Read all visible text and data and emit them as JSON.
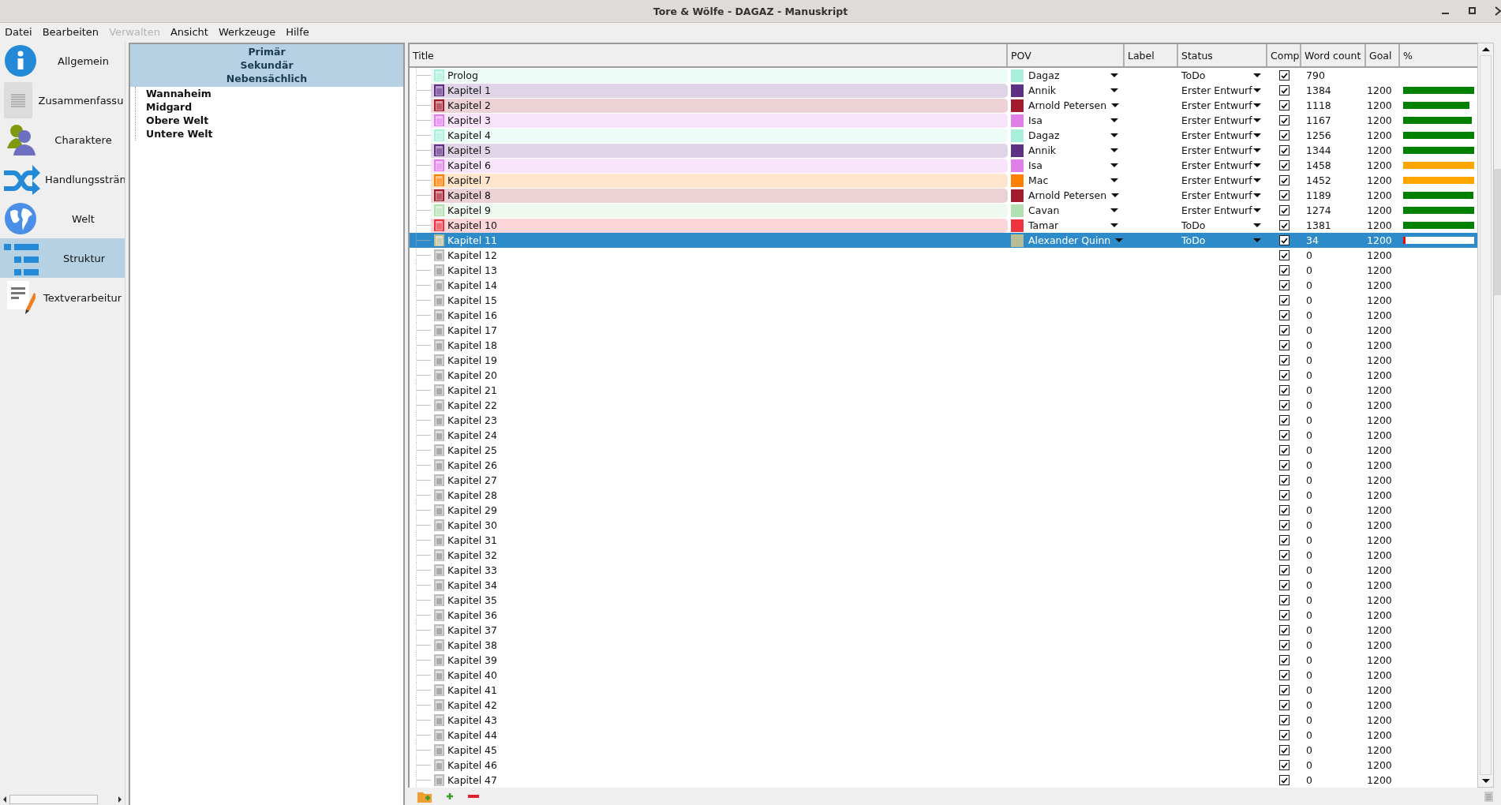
{
  "window": {
    "title": "Tore & Wölfe - DAGAZ - Manuskript"
  },
  "menu": [
    {
      "label": "Datei",
      "disabled": false
    },
    {
      "label": "Bearbeiten",
      "disabled": false
    },
    {
      "label": "Verwalten",
      "disabled": true
    },
    {
      "label": "Ansicht",
      "disabled": false
    },
    {
      "label": "Werkzeuge",
      "disabled": false
    },
    {
      "label": "Hilfe",
      "disabled": false
    }
  ],
  "sidebar": {
    "items": [
      {
        "label": "Allgemein",
        "kind": "info",
        "selected": false
      },
      {
        "label": "Zusammenfassu",
        "kind": "summary",
        "selected": false
      },
      {
        "label": "Charaktere",
        "kind": "characters",
        "selected": false
      },
      {
        "label": "Handlungssträn",
        "kind": "plots",
        "selected": false
      },
      {
        "label": "Welt",
        "kind": "world",
        "selected": false
      },
      {
        "label": "Struktur",
        "kind": "outline",
        "selected": true
      },
      {
        "label": "Textverarbeitur",
        "kind": "editor",
        "selected": false
      }
    ]
  },
  "world_panel": {
    "headers": [
      "Primär",
      "Sekundär",
      "Nebensächlich"
    ],
    "items": [
      "Wannaheim",
      "Midgard",
      "Obere Welt",
      "Untere Welt"
    ]
  },
  "table": {
    "columns": [
      "Title",
      "POV",
      "Label",
      "Status",
      "Comp",
      "Word count",
      "Goal",
      "%"
    ],
    "rows": [
      {
        "title": "Prolog",
        "pov": {
          "name": "Dagaz",
          "color": "#a8f0dc"
        },
        "status": "ToDo",
        "checked": true,
        "word_count": "790",
        "selected": false
      },
      {
        "title": "Kapitel 1",
        "pov": {
          "name": "Annik",
          "color": "#5f2f85"
        },
        "status": "Erster Entwurf",
        "checked": true,
        "word_count": "1384",
        "goal": "1200",
        "progress": {
          "level": 1,
          "color": "#008000"
        },
        "selected": false
      },
      {
        "title": "Kapitel 2",
        "pov": {
          "name": "Arnold Petersen",
          "color": "#a21c2e"
        },
        "status": "Erster Entwurf",
        "checked": true,
        "word_count": "1118",
        "goal": "1200",
        "progress": {
          "level": 0.93,
          "color": "#008000"
        },
        "selected": false
      },
      {
        "title": "Kapitel 3",
        "pov": {
          "name": "Isa",
          "color": "#e07fea"
        },
        "status": "Erster Entwurf",
        "checked": true,
        "word_count": "1167",
        "goal": "1200",
        "progress": {
          "level": 0.97,
          "color": "#008000"
        },
        "selected": false
      },
      {
        "title": "Kapitel 4",
        "pov": {
          "name": "Dagaz",
          "color": "#a8f0dc"
        },
        "status": "Erster Entwurf",
        "checked": true,
        "word_count": "1256",
        "goal": "1200",
        "progress": {
          "level": 1,
          "color": "#008000"
        },
        "selected": false
      },
      {
        "title": "Kapitel 5",
        "pov": {
          "name": "Annik",
          "color": "#5f2f85"
        },
        "status": "Erster Entwurf",
        "checked": true,
        "word_count": "1344",
        "goal": "1200",
        "progress": {
          "level": 1,
          "color": "#008000"
        },
        "selected": false
      },
      {
        "title": "Kapitel 6",
        "pov": {
          "name": "Isa",
          "color": "#e07fea"
        },
        "status": "Erster Entwurf",
        "checked": true,
        "word_count": "1458",
        "goal": "1200",
        "progress": {
          "level": 1,
          "color": "#ffa500"
        },
        "selected": false
      },
      {
        "title": "Kapitel 7",
        "pov": {
          "name": "Mac",
          "color": "#ff7f00"
        },
        "status": "Erster Entwurf",
        "checked": true,
        "word_count": "1452",
        "goal": "1200",
        "progress": {
          "level": 1,
          "color": "#ffa500"
        },
        "selected": false
      },
      {
        "title": "Kapitel 8",
        "pov": {
          "name": "Arnold Petersen",
          "color": "#a21c2e"
        },
        "status": "Erster Entwurf",
        "checked": true,
        "word_count": "1189",
        "goal": "1200",
        "progress": {
          "level": 0.99,
          "color": "#008000"
        },
        "selected": false
      },
      {
        "title": "Kapitel 9",
        "pov": {
          "name": "Cavan",
          "color": "#b3e0b3"
        },
        "status": "Erster Entwurf",
        "checked": true,
        "word_count": "1274",
        "goal": "1200",
        "progress": {
          "level": 1,
          "color": "#008000"
        },
        "selected": false
      },
      {
        "title": "Kapitel 10",
        "pov": {
          "name": "Tamar",
          "color": "#ee3340"
        },
        "status": "ToDo",
        "checked": true,
        "word_count": "1381",
        "goal": "1200",
        "progress": {
          "level": 1,
          "color": "#008000"
        },
        "selected": false
      },
      {
        "title": "Kapitel 11",
        "pov": {
          "name": "Alexander Quinn",
          "color": "#b9bd95"
        },
        "status": "ToDo",
        "checked": true,
        "word_count": "34",
        "goal": "1200",
        "progress": {
          "level": 0.03,
          "color": "#ff0000"
        },
        "selected": true
      },
      {
        "title": "Kapitel 12",
        "checked": true,
        "word_count": "0",
        "goal": "1200",
        "selected": false
      },
      {
        "title": "Kapitel 13",
        "checked": true,
        "word_count": "0",
        "goal": "1200",
        "selected": false
      },
      {
        "title": "Kapitel 14",
        "checked": true,
        "word_count": "0",
        "goal": "1200",
        "selected": false
      },
      {
        "title": "Kapitel 15",
        "checked": true,
        "word_count": "0",
        "goal": "1200",
        "selected": false
      },
      {
        "title": "Kapitel 16",
        "checked": true,
        "word_count": "0",
        "goal": "1200",
        "selected": false
      },
      {
        "title": "Kapitel 17",
        "checked": true,
        "word_count": "0",
        "goal": "1200",
        "selected": false
      },
      {
        "title": "Kapitel 18",
        "checked": true,
        "word_count": "0",
        "goal": "1200",
        "selected": false
      },
      {
        "title": "Kapitel 19",
        "checked": true,
        "word_count": "0",
        "goal": "1200",
        "selected": false
      },
      {
        "title": "Kapitel 20",
        "checked": true,
        "word_count": "0",
        "goal": "1200",
        "selected": false
      },
      {
        "title": "Kapitel 21",
        "checked": true,
        "word_count": "0",
        "goal": "1200",
        "selected": false
      },
      {
        "title": "Kapitel 22",
        "checked": true,
        "word_count": "0",
        "goal": "1200",
        "selected": false
      },
      {
        "title": "Kapitel 23",
        "checked": true,
        "word_count": "0",
        "goal": "1200",
        "selected": false
      },
      {
        "title": "Kapitel 24",
        "checked": true,
        "word_count": "0",
        "goal": "1200",
        "selected": false
      },
      {
        "title": "Kapitel 25",
        "checked": true,
        "word_count": "0",
        "goal": "1200",
        "selected": false
      },
      {
        "title": "Kapitel 26",
        "checked": true,
        "word_count": "0",
        "goal": "1200",
        "selected": false
      },
      {
        "title": "Kapitel 27",
        "checked": true,
        "word_count": "0",
        "goal": "1200",
        "selected": false
      },
      {
        "title": "Kapitel 28",
        "checked": true,
        "word_count": "0",
        "goal": "1200",
        "selected": false
      },
      {
        "title": "Kapitel 29",
        "checked": true,
        "word_count": "0",
        "goal": "1200",
        "selected": false
      },
      {
        "title": "Kapitel 30",
        "checked": true,
        "word_count": "0",
        "goal": "1200",
        "selected": false
      },
      {
        "title": "Kapitel 31",
        "checked": true,
        "word_count": "0",
        "goal": "1200",
        "selected": false
      },
      {
        "title": "Kapitel 32",
        "checked": true,
        "word_count": "0",
        "goal": "1200",
        "selected": false
      },
      {
        "title": "Kapitel 33",
        "checked": true,
        "word_count": "0",
        "goal": "1200",
        "selected": false
      },
      {
        "title": "Kapitel 34",
        "checked": true,
        "word_count": "0",
        "goal": "1200",
        "selected": false
      },
      {
        "title": "Kapitel 35",
        "checked": true,
        "word_count": "0",
        "goal": "1200",
        "selected": false
      },
      {
        "title": "Kapitel 36",
        "checked": true,
        "word_count": "0",
        "goal": "1200",
        "selected": false
      },
      {
        "title": "Kapitel 37",
        "checked": true,
        "word_count": "0",
        "goal": "1200",
        "selected": false
      },
      {
        "title": "Kapitel 38",
        "checked": true,
        "word_count": "0",
        "goal": "1200",
        "selected": false
      },
      {
        "title": "Kapitel 39",
        "checked": true,
        "word_count": "0",
        "goal": "1200",
        "selected": false
      },
      {
        "title": "Kapitel 40",
        "checked": true,
        "word_count": "0",
        "goal": "1200",
        "selected": false
      },
      {
        "title": "Kapitel 41",
        "checked": true,
        "word_count": "0",
        "goal": "1200",
        "selected": false
      },
      {
        "title": "Kapitel 42",
        "checked": true,
        "word_count": "0",
        "goal": "1200",
        "selected": false
      },
      {
        "title": "Kapitel 43",
        "checked": true,
        "word_count": "0",
        "goal": "1200",
        "selected": false
      },
      {
        "title": "Kapitel 44",
        "checked": true,
        "word_count": "0",
        "goal": "1200",
        "selected": false
      },
      {
        "title": "Kapitel 45",
        "checked": true,
        "word_count": "0",
        "goal": "1200",
        "selected": false
      },
      {
        "title": "Kapitel 46",
        "checked": true,
        "word_count": "0",
        "goal": "1200",
        "selected": false
      },
      {
        "title": "Kapitel 47",
        "checked": true,
        "word_count": "0",
        "goal": "1200",
        "selected": false
      }
    ]
  }
}
